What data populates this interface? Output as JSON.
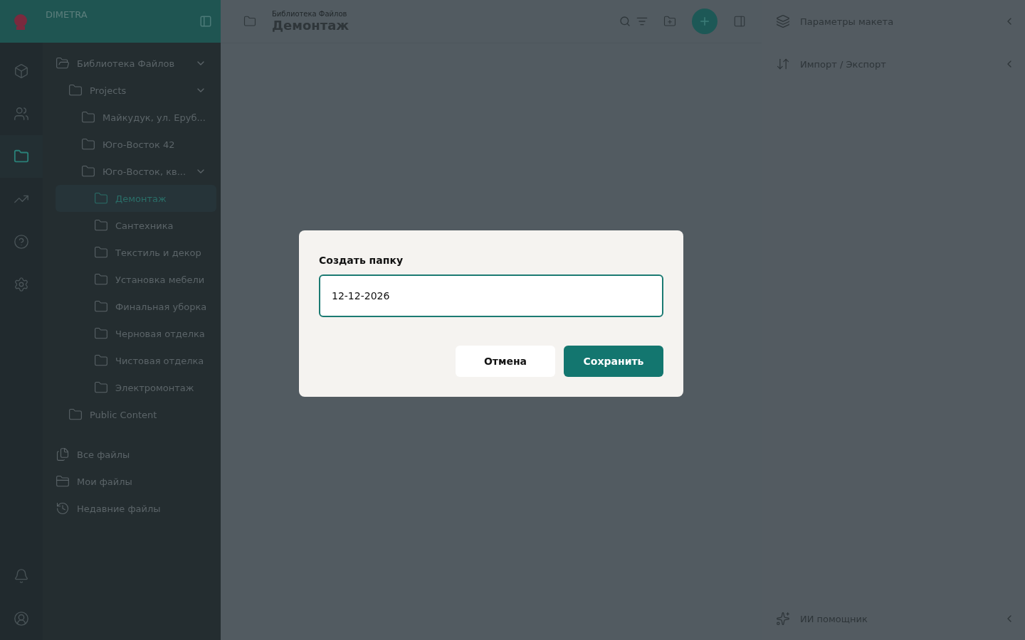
{
  "brand": {
    "name": "DIMETRA"
  },
  "rail": [
    {
      "kind": "box",
      "selected": false
    },
    {
      "kind": "users",
      "selected": false
    },
    {
      "kind": "folder",
      "selected": true
    },
    {
      "kind": "trend",
      "selected": false
    },
    {
      "kind": "help",
      "selected": false
    },
    {
      "kind": "settings",
      "selected": false
    }
  ],
  "rail_bottom": [
    {
      "kind": "bell"
    },
    {
      "kind": "user"
    }
  ],
  "tree": [
    {
      "label": "Библиотека Файлов",
      "kind": "library",
      "expanded": true,
      "selected": false,
      "children": [
        {
          "label": "Projects",
          "expanded": true,
          "selected": false,
          "children": [
            {
              "label": "Майкудук, ул. Еруб...",
              "selected": false
            },
            {
              "label": "Юго-Восток 42",
              "selected": false
            },
            {
              "label": "Юго-Восток, кв...",
              "expanded": true,
              "selected": false,
              "children": [
                {
                  "label": "Демонтаж",
                  "selected": true
                },
                {
                  "label": "Сантехника",
                  "selected": false
                },
                {
                  "label": "Текстиль и декор",
                  "selected": false
                },
                {
                  "label": "Установка мебели",
                  "selected": false
                },
                {
                  "label": "Финальная уборка",
                  "selected": false
                },
                {
                  "label": "Черновая отделка",
                  "selected": false
                },
                {
                  "label": "Чистовая отделка",
                  "selected": false
                },
                {
                  "label": "Электромонтаж",
                  "selected": false
                }
              ]
            }
          ]
        },
        {
          "label": "Public Content",
          "selected": false
        }
      ]
    }
  ],
  "quick_links": [
    {
      "label": "Все файлы",
      "kind": "files"
    },
    {
      "label": "Мои файлы",
      "kind": "mine"
    },
    {
      "label": "Недавние файлы",
      "kind": "recent"
    }
  ],
  "header": {
    "breadcrumb": "Библиотека Файлов",
    "title": "Демонтаж"
  },
  "right_panel": [
    {
      "label": "Параметры макета",
      "kind": "layers"
    },
    {
      "label": "Импорт / Экспорт",
      "kind": "import"
    }
  ],
  "right_bottom": {
    "label": "ИИ помощник"
  },
  "dialog": {
    "title": "Создать папку",
    "value": "12-12-2026",
    "cancel": "Отмена",
    "save": "Сохранить"
  }
}
